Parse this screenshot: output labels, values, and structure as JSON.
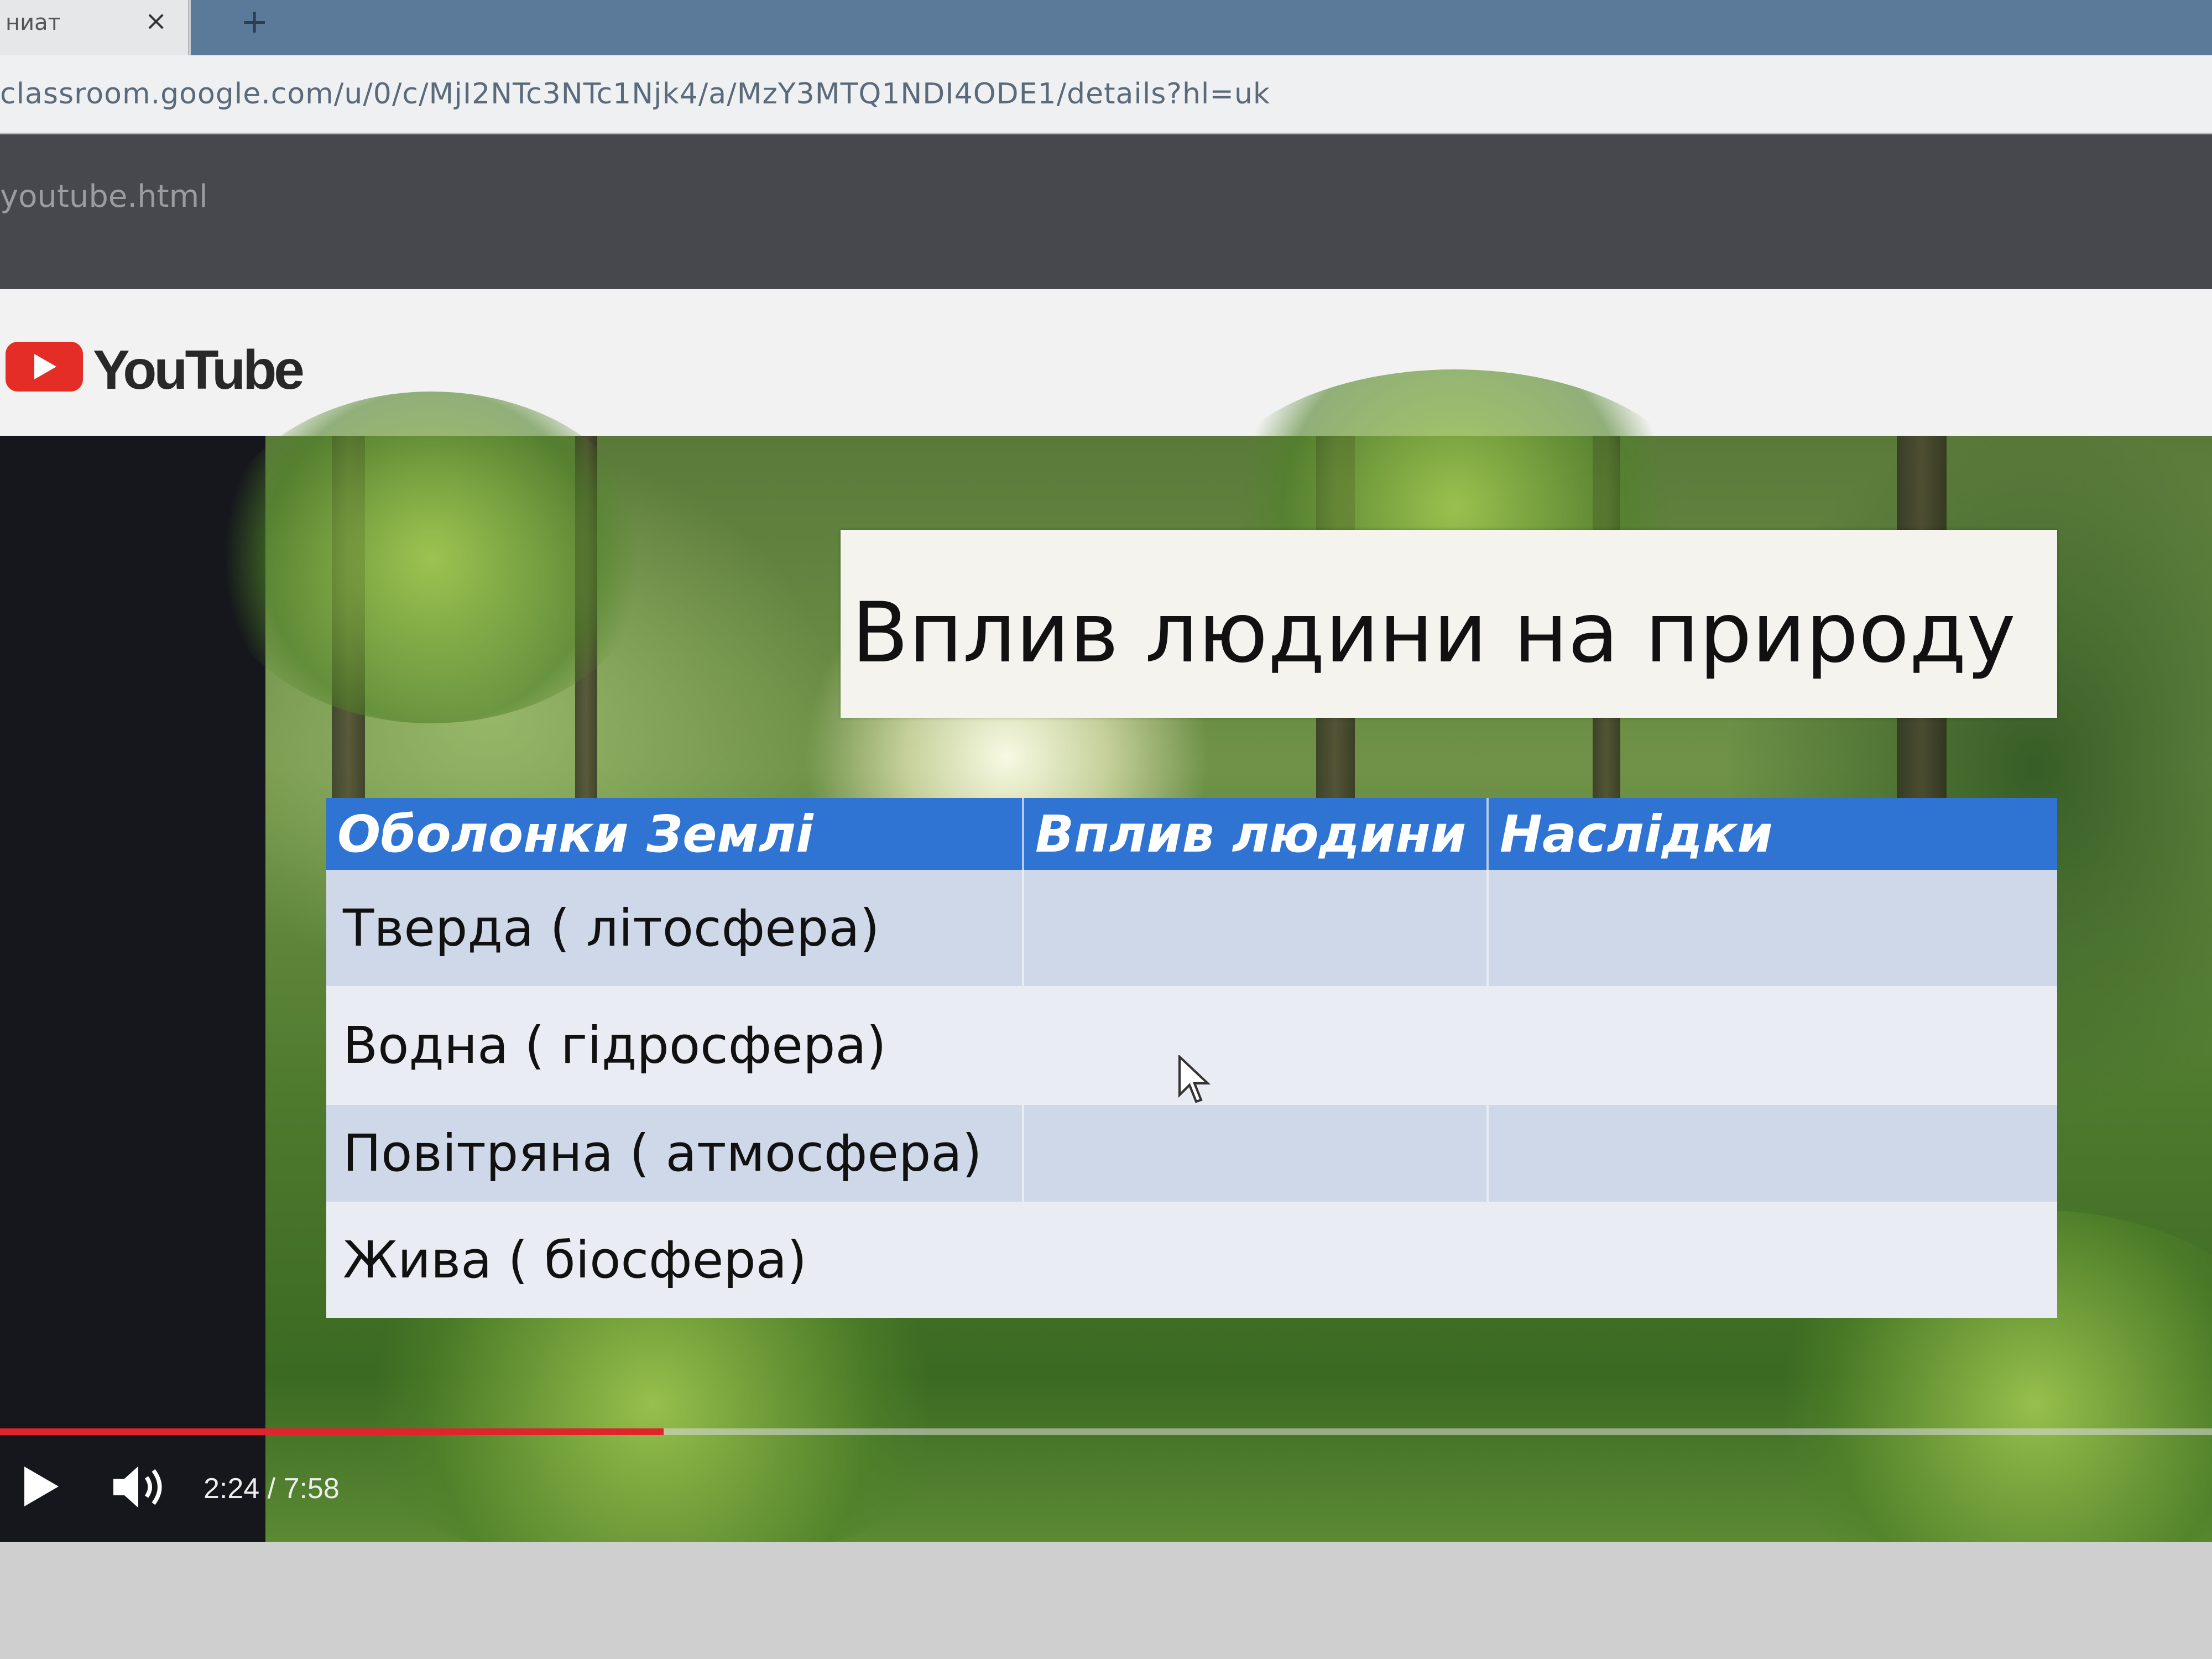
{
  "browser": {
    "tab_title": "ниат",
    "tab_close": "×",
    "new_tab": "+",
    "url": "classroom.google.com/u/0/c/MjI2NTc3NTc1Njk4/a/MzY3MTQ1NDI4ODE1/details?hl=uk",
    "bookmark_text": "youtube.html"
  },
  "youtube": {
    "logo_text": "YouTube"
  },
  "slide": {
    "title": "Вплив людини на природу",
    "table": {
      "headers": [
        "Оболонки Землі",
        "Вплив людини",
        "Наслідки"
      ],
      "rows": [
        [
          "Тверда ( літосфера)",
          "",
          ""
        ],
        [
          "Водна ( гідросфера)",
          "",
          ""
        ],
        [
          "Повітряна ( атмосфера)",
          "",
          ""
        ],
        [
          "Жива ( біосфера)",
          "",
          ""
        ]
      ]
    }
  },
  "player": {
    "time_display": "2:24 / 7:58",
    "current_time": "2:24",
    "duration": "7:58",
    "progress_fraction": 0.3,
    "play_icon": "play-icon",
    "volume_icon": "volume-icon"
  },
  "colors": {
    "youtube_red": "#e52d27",
    "progress_red": "#e0242b",
    "table_header_blue": "#2f74d2"
  }
}
